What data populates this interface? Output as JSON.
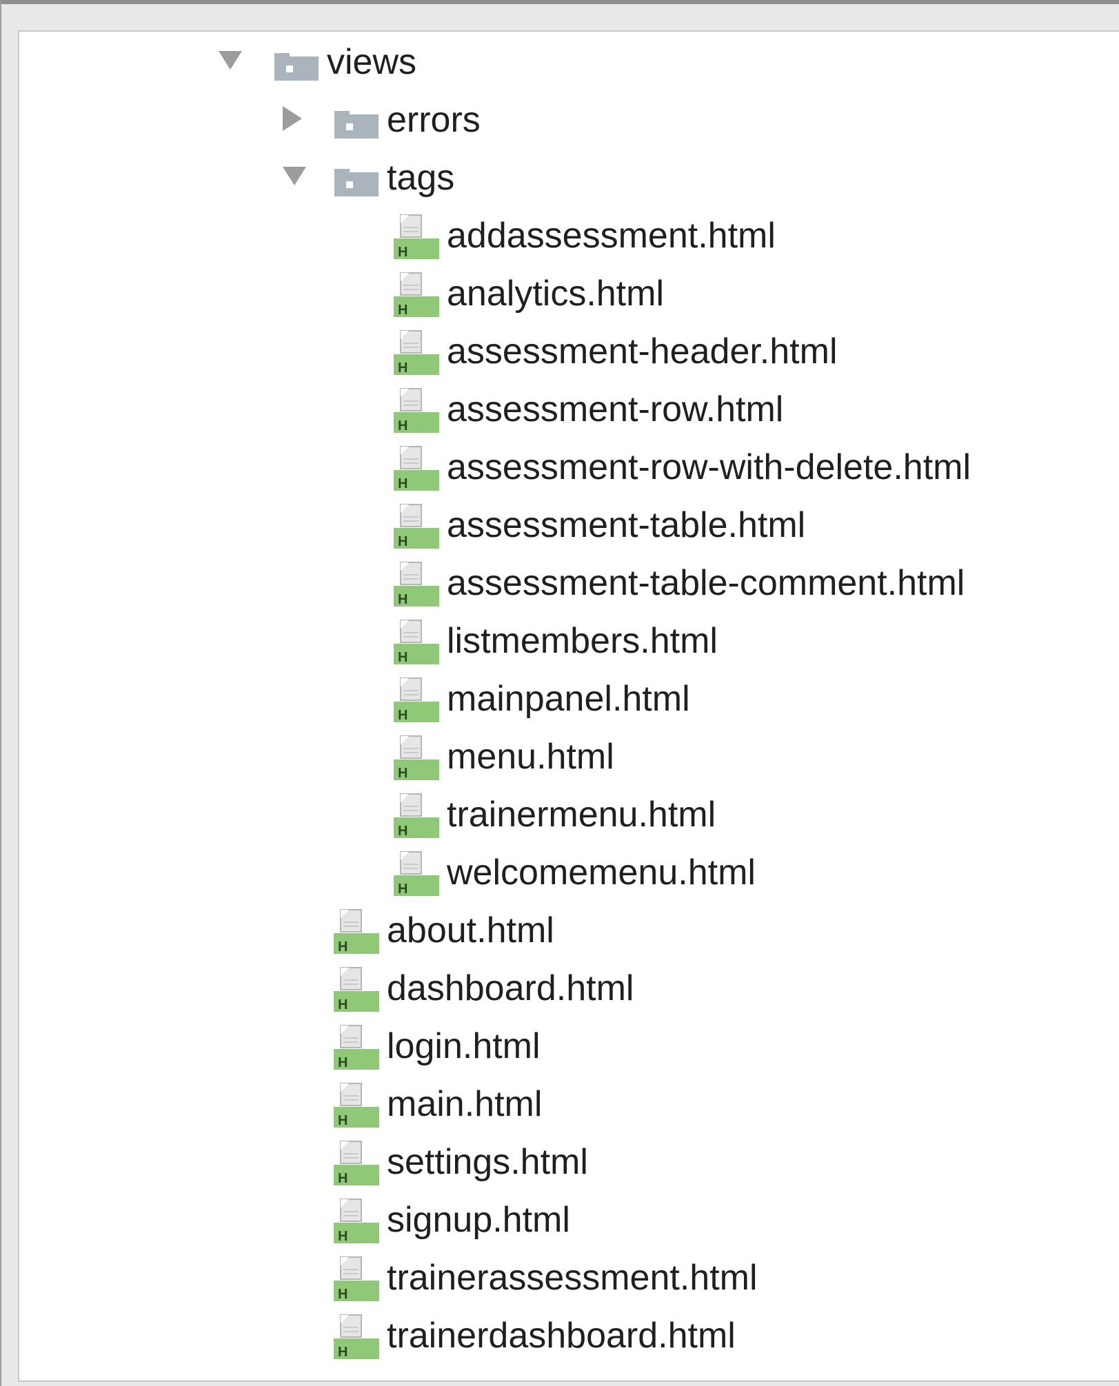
{
  "tree": {
    "root": {
      "label": "views",
      "icon": "folder-icon",
      "expanded": true
    },
    "folders": [
      {
        "label": "errors",
        "icon": "folder-icon",
        "expanded": false
      },
      {
        "label": "tags",
        "icon": "folder-icon",
        "expanded": true
      }
    ],
    "tags_files": [
      "addassessment.html",
      "analytics.html",
      "assessment-header.html",
      "assessment-row.html",
      "assessment-row-with-delete.html",
      "assessment-table.html",
      "assessment-table-comment.html",
      "listmembers.html",
      "mainpanel.html",
      "menu.html",
      "trainermenu.html",
      "welcomemenu.html"
    ],
    "views_files": [
      "about.html",
      "dashboard.html",
      "login.html",
      "main.html",
      "settings.html",
      "signup.html",
      "trainerassessment.html",
      "trainerdashboard.html"
    ],
    "file_icon": "html-file-icon",
    "file_icon_letter": "H",
    "colors": {
      "folder": "#a9b4bd",
      "file_badge": "#8fc978",
      "arrow": "#9c9c9c",
      "text": "#1f1f1f"
    }
  }
}
